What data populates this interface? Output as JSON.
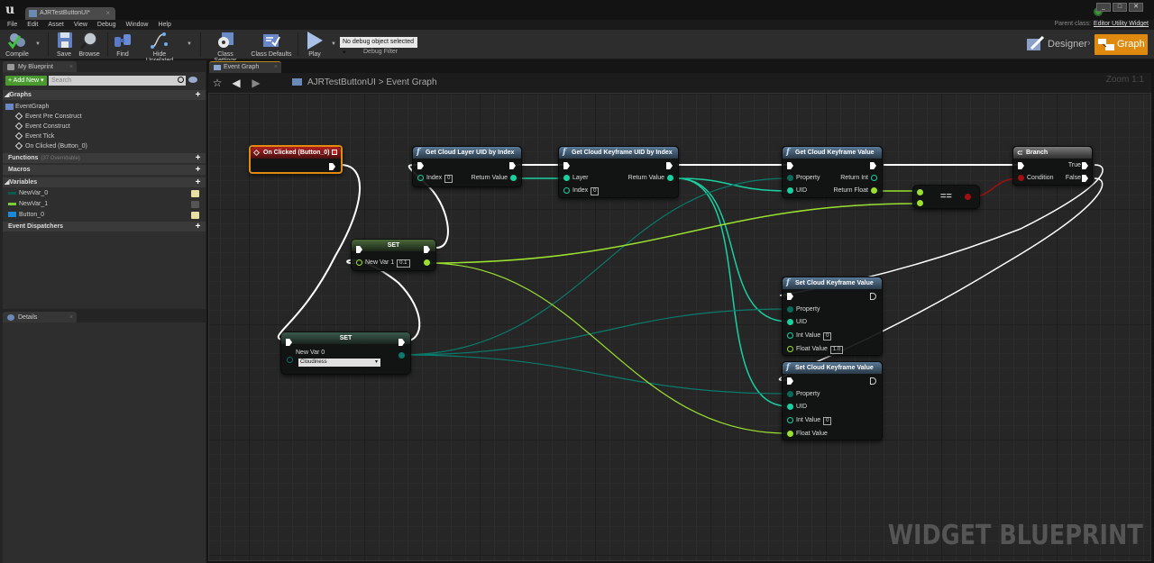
{
  "window": {
    "doc_tab": "AJRTestButtonUI*",
    "parent_class_label": "Parent class:",
    "parent_class_value": "Editor Utility Widget",
    "controls": [
      "_",
      "□",
      "✕"
    ]
  },
  "menu": [
    "File",
    "Edit",
    "Asset",
    "View",
    "Debug",
    "Window",
    "Help"
  ],
  "toolbar": {
    "compile": "Compile",
    "save": "Save",
    "browse": "Browse",
    "find": "Find",
    "hide_unrelated": "Hide Unrelated",
    "class_settings": "Class Settings",
    "class_defaults": "Class Defaults",
    "play": "Play",
    "debug_select": "No debug object selected",
    "debug_filter": "Debug Filter"
  },
  "modes": {
    "designer": "Designer",
    "graph": "Graph",
    "active": "Graph",
    "accent": "#e0890f"
  },
  "my_blueprint": {
    "tab": "My Blueprint",
    "add_new": "Add New",
    "search_placeholder": "Search",
    "sections": {
      "graphs": "Graphs",
      "functions": "Functions",
      "functions_count": "(37 Overridable)",
      "macros": "Macros",
      "variables": "Variables",
      "event_dispatchers": "Event Dispatchers"
    },
    "event_graph": "EventGraph",
    "events": [
      "Event Pre Construct",
      "Event Construct",
      "Event Tick",
      "On Clicked (Button_0)"
    ],
    "variables": [
      {
        "name": "NewVar_0",
        "color": "#0a5a50"
      },
      {
        "name": "NewVar_1",
        "color": "#7ad030"
      },
      {
        "name": "Button_0",
        "color": "#1a8ad8"
      }
    ]
  },
  "details": {
    "tab": "Details"
  },
  "graph": {
    "tab": "Event Graph",
    "breadcrumb_root": "AJRTestButtonUI",
    "breadcrumb_sep": ">",
    "breadcrumb_leaf": "Event Graph",
    "zoom": "Zoom 1:1",
    "watermark": "WIDGET BLUEPRINT"
  },
  "nodes": {
    "on_clicked": {
      "title": "On Clicked (Button_0)"
    },
    "get_layer_uid": {
      "title": "Get Cloud Layer UID by Index",
      "in_index": "Index",
      "in_index_val": "0",
      "out": "Return Value"
    },
    "get_kf_uid": {
      "title": "Get Cloud Keyframe UID by Index",
      "in_layer": "Layer",
      "in_index": "Index",
      "in_index_val": "0",
      "out": "Return Value"
    },
    "get_kf_value": {
      "title": "Get Cloud Keyframe Value",
      "in_property": "Property",
      "in_uid": "UID",
      "out_int": "Return Int",
      "out_float": "Return Float"
    },
    "branch": {
      "title": "Branch",
      "in_cond": "Condition",
      "out_true": "True",
      "out_false": "False"
    },
    "equals": {
      "title": "=="
    },
    "set1": {
      "title": "SET",
      "var": "New Var 1",
      "val": "0.1"
    },
    "set0": {
      "title": "SET",
      "var": "New Var 0",
      "val": "Cloudiness"
    },
    "set_kf_a": {
      "title": "Set Cloud Keyframe Value",
      "property": "Property",
      "uid": "UID",
      "int_label": "Int Value",
      "int_val": "0",
      "float_label": "Float Value",
      "float_val": "1.0"
    },
    "set_kf_b": {
      "title": "Set Cloud Keyframe Value",
      "property": "Property",
      "uid": "UID",
      "int_label": "Int Value",
      "int_val": "0",
      "float_label": "Float Value"
    }
  },
  "colors": {
    "exec": "#ffffff",
    "struct": "#1ad0a0",
    "enum": "#0a6a5a",
    "float": "#9ae030",
    "bool": "#a01010"
  }
}
